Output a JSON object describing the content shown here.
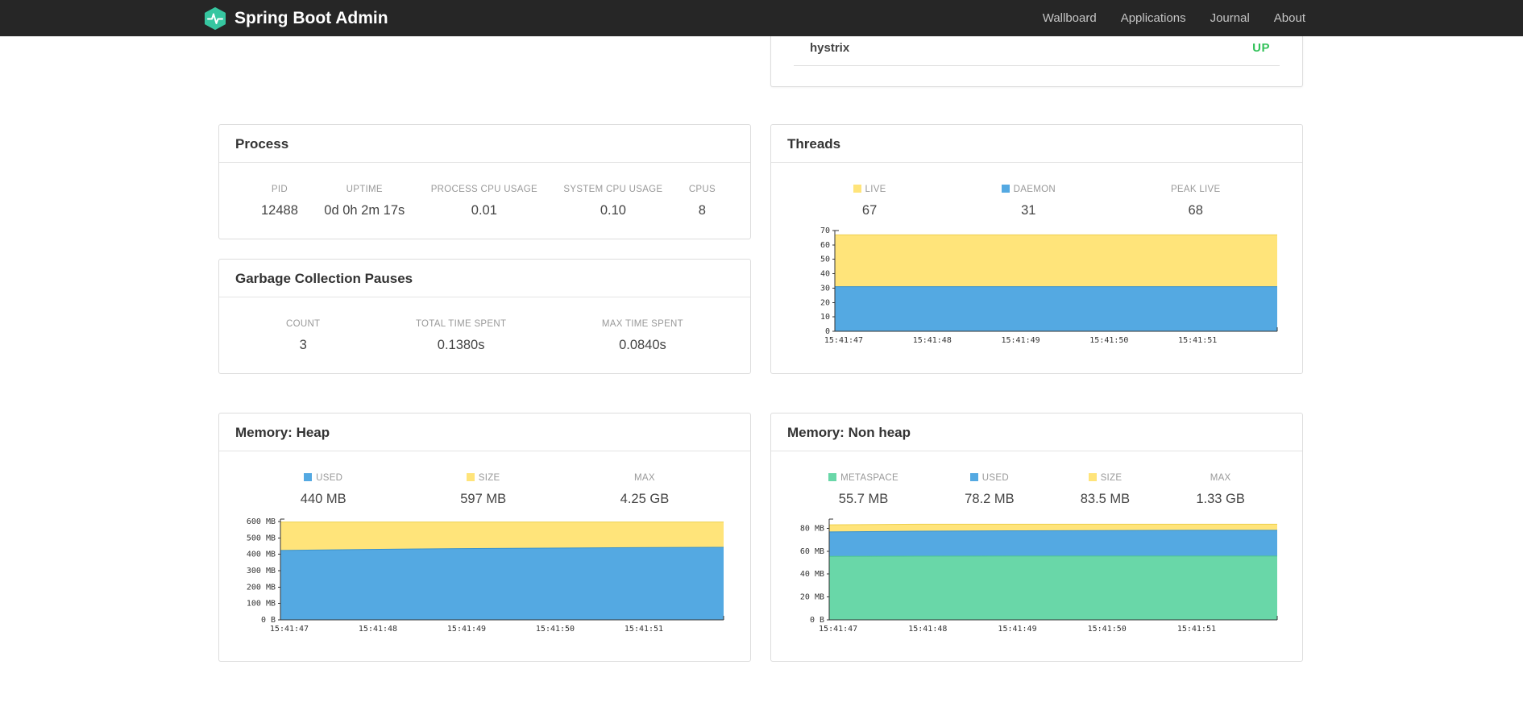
{
  "navbar": {
    "brand": "Spring Boot Admin",
    "logo_color": "#36c6a0",
    "links": [
      {
        "label": "Wallboard"
      },
      {
        "label": "Applications"
      },
      {
        "label": "Journal"
      },
      {
        "label": "About"
      }
    ]
  },
  "application": {
    "name": "hystrix",
    "status": "UP",
    "status_color": "#33c25a"
  },
  "panels": {
    "process": {
      "title": "Process",
      "metrics": [
        {
          "label": "PID",
          "value": "12488"
        },
        {
          "label": "UPTIME",
          "value": "0d 0h 2m 17s"
        },
        {
          "label": "PROCESS CPU USAGE",
          "value": "0.01"
        },
        {
          "label": "SYSTEM CPU USAGE",
          "value": "0.10"
        },
        {
          "label": "CPUS",
          "value": "8"
        }
      ]
    },
    "gc": {
      "title": "Garbage Collection Pauses",
      "metrics": [
        {
          "label": "COUNT",
          "value": "3"
        },
        {
          "label": "TOTAL TIME SPENT",
          "value": "0.1380s"
        },
        {
          "label": "MAX TIME SPENT",
          "value": "0.0840s"
        }
      ]
    },
    "threads": {
      "title": "Threads",
      "legend": [
        {
          "label": "LIVE",
          "value": "67",
          "swatch": "#ffe47a"
        },
        {
          "label": "DAEMON",
          "value": "31",
          "swatch": "#54a9e2"
        },
        {
          "label": "PEAK LIVE",
          "value": "68"
        }
      ]
    },
    "heap": {
      "title": "Memory: Heap",
      "legend": [
        {
          "label": "USED",
          "value": "440 MB",
          "swatch": "#54a9e2"
        },
        {
          "label": "SIZE",
          "value": "597 MB",
          "swatch": "#ffe47a"
        },
        {
          "label": "MAX",
          "value": "4.25 GB"
        }
      ]
    },
    "nonheap": {
      "title": "Memory: Non heap",
      "legend": [
        {
          "label": "METASPACE",
          "value": "55.7 MB",
          "swatch": "#69d7a8"
        },
        {
          "label": "USED",
          "value": "78.2 MB",
          "swatch": "#54a9e2"
        },
        {
          "label": "SIZE",
          "value": "83.5 MB",
          "swatch": "#ffe47a"
        },
        {
          "label": "MAX",
          "value": "1.33 GB"
        }
      ]
    }
  },
  "chart_data": [
    {
      "type": "area",
      "title": "Threads",
      "x_tick_labels": [
        "15:41:47",
        "15:41:48",
        "15:41:49",
        "15:41:50",
        "15:41:51"
      ],
      "ylim": [
        0,
        70
      ],
      "yticks": [
        0,
        10,
        20,
        30,
        40,
        50,
        60,
        70
      ],
      "ytick_labels": [
        "0",
        "10",
        "20",
        "30",
        "40",
        "50",
        "60",
        "70"
      ],
      "legend_position": "top",
      "grid": false,
      "series": [
        {
          "name": "LIVE",
          "color": "#ffe47a",
          "edge": "#edd04e",
          "values": [
            67,
            67,
            67,
            67,
            67,
            67
          ]
        },
        {
          "name": "DAEMON",
          "color": "#54a9e2",
          "edge": "#3b92cc",
          "values": [
            31,
            31,
            31,
            31,
            31,
            31
          ]
        }
      ]
    },
    {
      "type": "area",
      "title": "Memory: Heap",
      "x_tick_labels": [
        "15:41:47",
        "15:41:48",
        "15:41:49",
        "15:41:50",
        "15:41:51"
      ],
      "ylim": [
        0,
        615
      ],
      "yticks": [
        0,
        100,
        200,
        300,
        400,
        500,
        600
      ],
      "ytick_labels": [
        "0 B",
        "100 MB",
        "200 MB",
        "300 MB",
        "400 MB",
        "500 MB",
        "600 MB"
      ],
      "legend_position": "top",
      "grid": false,
      "series": [
        {
          "name": "SIZE",
          "color": "#ffe47a",
          "edge": "#edd04e",
          "values": [
            597,
            597,
            597,
            597,
            597,
            597
          ]
        },
        {
          "name": "USED",
          "color": "#54a9e2",
          "edge": "#3b92cc",
          "values": [
            424,
            430,
            435,
            438,
            441,
            443
          ]
        }
      ]
    },
    {
      "type": "area",
      "title": "Memory: Non heap",
      "x_tick_labels": [
        "15:41:47",
        "15:41:48",
        "15:41:49",
        "15:41:50",
        "15:41:51"
      ],
      "ylim": [
        0,
        88
      ],
      "yticks": [
        0,
        20,
        40,
        60,
        80
      ],
      "ytick_labels": [
        "0 B",
        "20 MB",
        "40 MB",
        "60 MB",
        "80 MB"
      ],
      "legend_position": "top",
      "grid": false,
      "series": [
        {
          "name": "SIZE",
          "color": "#ffe47a",
          "edge": "#edd04e",
          "values": [
            83,
            83.5,
            83.5,
            83.5,
            83.5,
            83.5
          ]
        },
        {
          "name": "USED",
          "color": "#54a9e2",
          "edge": "#3b92cc",
          "values": [
            76.8,
            77.4,
            77.8,
            78,
            78.2,
            78.2
          ]
        },
        {
          "name": "METASPACE",
          "color": "#69d7a8",
          "edge": "#4cc493",
          "values": [
            55.4,
            55.6,
            55.7,
            55.7,
            55.7,
            55.7
          ]
        }
      ]
    }
  ]
}
